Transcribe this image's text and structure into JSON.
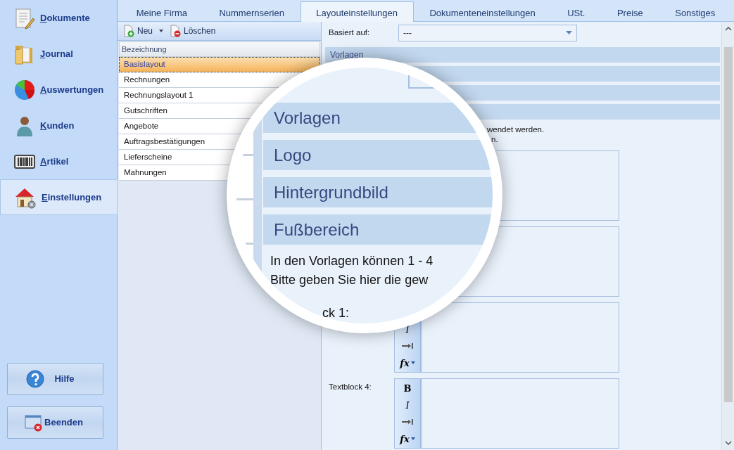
{
  "sidebar": {
    "items": [
      {
        "label": "Dokumente",
        "kind": "documents",
        "selected": false
      },
      {
        "label": "Journal",
        "kind": "folder",
        "selected": false
      },
      {
        "label": "Auswertungen",
        "kind": "chart",
        "selected": false
      },
      {
        "label": "Kunden",
        "kind": "person",
        "selected": false
      },
      {
        "label": "Artikel",
        "kind": "barcode",
        "selected": false
      },
      {
        "label": "Einstellungen",
        "kind": "house",
        "selected": true
      }
    ],
    "buttons": [
      {
        "label": "Hilfe",
        "kind": "help"
      },
      {
        "label": "Beenden",
        "kind": "exit"
      }
    ]
  },
  "tabs": [
    {
      "label": "Meine Firma",
      "selected": false
    },
    {
      "label": "Nummernserien",
      "selected": false
    },
    {
      "label": "Layouteinstellungen",
      "selected": true
    },
    {
      "label": "Dokumenteneinstellungen",
      "selected": false
    },
    {
      "label": "USt.",
      "selected": false
    },
    {
      "label": "Preise",
      "selected": false
    },
    {
      "label": "Sonstiges",
      "selected": false
    }
  ],
  "layout_list": {
    "toolbar": [
      {
        "label": "Neu",
        "kind": "new",
        "dropdown": true
      },
      {
        "label": "Löschen",
        "kind": "delete",
        "dropdown": false
      }
    ],
    "column": "Bezeichnung",
    "rows": [
      {
        "label": "Basislayout",
        "selected": true
      },
      {
        "label": "Rechnungen",
        "selected": false
      },
      {
        "label": "Rechnungslayout 1",
        "selected": false
      },
      {
        "label": "Gutschriften",
        "selected": false
      },
      {
        "label": "Angebote",
        "selected": false
      },
      {
        "label": "Auftragsbestätigungen",
        "selected": false
      },
      {
        "label": "Lieferscheine",
        "selected": false
      },
      {
        "label": "Mahnungen",
        "selected": false
      }
    ]
  },
  "settings": {
    "based_on": {
      "label": "Basiert auf:",
      "value": "---"
    },
    "sections": [
      {
        "kind": "labelled",
        "label": "Vorlagen"
      },
      {
        "kind": "covered"
      },
      {
        "kind": "covered"
      },
      {
        "kind": "covered"
      }
    ],
    "description_fragments": [
      "wendet werden.",
      "n."
    ],
    "editors": [
      {
        "kind": "covered"
      },
      {
        "kind": "covered"
      },
      {
        "kind": "editor",
        "tools": [
          {
            "kind": "italic",
            "label": "I"
          },
          {
            "kind": "indent"
          },
          {
            "kind": "function",
            "label": "fx"
          }
        ]
      },
      {
        "kind": "editor",
        "label": "Textblock 4:",
        "tools": [
          {
            "kind": "bold",
            "label": "B"
          },
          {
            "kind": "italic",
            "label": "I"
          },
          {
            "kind": "indent"
          },
          {
            "kind": "function",
            "label": "fx"
          }
        ]
      }
    ]
  },
  "magnifier": {
    "bars": [
      "Vorlagen",
      "Logo",
      "Hintergrundbild",
      "Fußbereich"
    ],
    "lines": [
      "In den Vorlagen können 1 - 4",
      "Bitte geben Sie hier die gew"
    ],
    "bottom_fragment": "ck 1:"
  }
}
